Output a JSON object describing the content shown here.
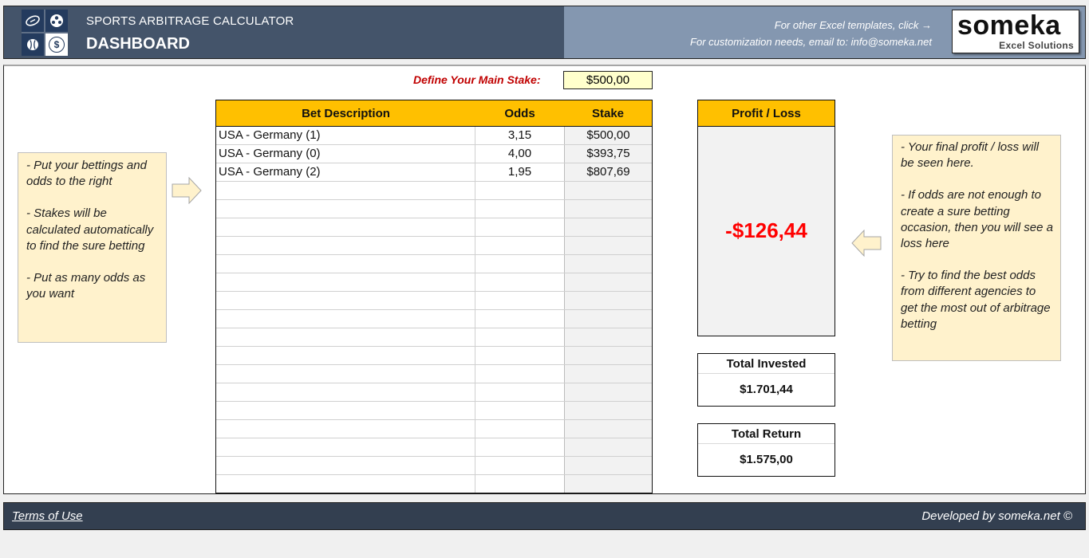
{
  "header": {
    "subtitle": "SPORTS ARBITRAGE CALCULATOR",
    "title": "DASHBOARD",
    "templates_link": "For other Excel templates, click →",
    "customization_text": "For customization needs, email to: info@someka.net",
    "brand_name": "someka",
    "brand_tagline": "Excel Solutions",
    "logo_icons": [
      "football-icon",
      "soccer-ball-icon",
      "baseball-icon",
      "dollar-icon"
    ]
  },
  "stake": {
    "label": "Define Your Main Stake:",
    "value": "$500,00"
  },
  "table": {
    "columns": [
      "Bet Description",
      "Odds",
      "Stake"
    ],
    "rows": [
      {
        "description": "USA - Germany (1)",
        "odds": "3,15",
        "stake": "$500,00"
      },
      {
        "description": "USA - Germany (0)",
        "odds": "4,00",
        "stake": "$393,75"
      },
      {
        "description": "USA - Germany (2)",
        "odds": "1,95",
        "stake": "$807,69"
      },
      {
        "description": "",
        "odds": "",
        "stake": ""
      },
      {
        "description": "",
        "odds": "",
        "stake": ""
      },
      {
        "description": "",
        "odds": "",
        "stake": ""
      },
      {
        "description": "",
        "odds": "",
        "stake": ""
      },
      {
        "description": "",
        "odds": "",
        "stake": ""
      },
      {
        "description": "",
        "odds": "",
        "stake": ""
      },
      {
        "description": "",
        "odds": "",
        "stake": ""
      },
      {
        "description": "",
        "odds": "",
        "stake": ""
      },
      {
        "description": "",
        "odds": "",
        "stake": ""
      },
      {
        "description": "",
        "odds": "",
        "stake": ""
      },
      {
        "description": "",
        "odds": "",
        "stake": ""
      },
      {
        "description": "",
        "odds": "",
        "stake": ""
      },
      {
        "description": "",
        "odds": "",
        "stake": ""
      },
      {
        "description": "",
        "odds": "",
        "stake": ""
      },
      {
        "description": "",
        "odds": "",
        "stake": ""
      },
      {
        "description": "",
        "odds": "",
        "stake": ""
      },
      {
        "description": "",
        "odds": "",
        "stake": ""
      }
    ]
  },
  "notes": {
    "left": [
      "- Put your bettings and odds to the right",
      "- Stakes will be calculated automatically to find the sure betting",
      "- Put as many odds as you want"
    ],
    "right": [
      "- Your final profit / loss will be seen here.",
      "- If odds are not enough to create a sure betting occasion, then you will see a loss here",
      "- Try to find the best odds from different agencies to get the most out of arbitrage betting"
    ]
  },
  "results": {
    "profit_loss_label": "Profit / Loss",
    "profit_loss_value": "-$126,44",
    "total_invested_label": "Total Invested",
    "total_invested_value": "$1.701,44",
    "total_return_label": "Total Return",
    "total_return_value": "$1.575,00"
  },
  "footer": {
    "terms_label": "Terms of Use",
    "developed_by": "Developed by someka.net ©"
  },
  "colors": {
    "header_dark": "#44546a",
    "header_light": "#8497b0",
    "accent_gold": "#ffc000",
    "note_bg": "#fff2cc",
    "loss_red": "#ff0000",
    "label_red": "#c00000",
    "footer_bg": "#333f50"
  }
}
